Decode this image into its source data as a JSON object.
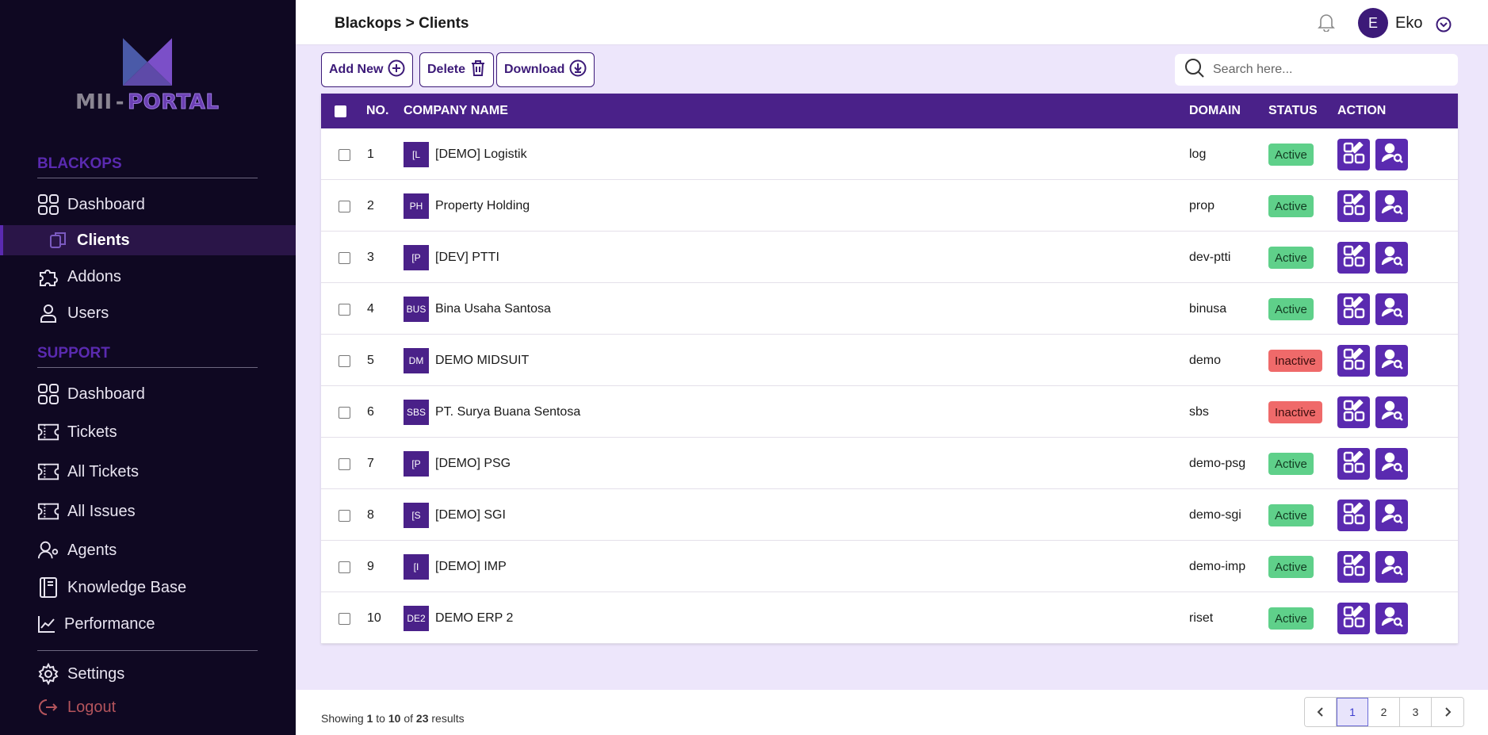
{
  "app": {
    "logo": {
      "part1": "MII",
      "separator": "-",
      "part2": "PORTAL"
    }
  },
  "sidebar": {
    "section1": "BLACKOPS",
    "section1_items": [
      {
        "label": "Dashboard",
        "icon": "grid-icon"
      },
      {
        "label": "Clients",
        "icon": "clients-icon",
        "active": true
      },
      {
        "label": "Addons",
        "icon": "puzzle-icon"
      },
      {
        "label": "Users",
        "icon": "user-icon"
      }
    ],
    "section2": "SUPPORT",
    "section2_items": [
      {
        "label": "Dashboard",
        "icon": "grid-icon"
      },
      {
        "label": "Tickets",
        "icon": "ticket-icon"
      },
      {
        "label": "All Tickets",
        "icon": "ticket-icon"
      },
      {
        "label": "All Issues",
        "icon": "ticket-icon"
      },
      {
        "label": "Agents",
        "icon": "agent-icon"
      },
      {
        "label": "Knowledge Base",
        "icon": "book-icon"
      },
      {
        "label": "Performance",
        "icon": "chart-line-icon"
      }
    ],
    "settings": "Settings",
    "logout": "Logout"
  },
  "header": {
    "breadcrumb": "Blackops > Clients",
    "user_initial": "E",
    "user_name": "Eko"
  },
  "toolbar": {
    "add_label": "Add New",
    "delete_label": "Delete",
    "download_label": "Download",
    "search_placeholder": "Search here..."
  },
  "table": {
    "columns": {
      "no": "NO.",
      "company": "COMPANY NAME",
      "domain": "DOMAIN",
      "status": "STATUS",
      "action": "ACTION"
    },
    "rows": [
      {
        "no": "1",
        "badge": "[L",
        "name": "[DEMO] Logistik",
        "domain": "log",
        "status": "Active"
      },
      {
        "no": "2",
        "badge": "PH",
        "name": "Property Holding",
        "domain": "prop",
        "status": "Active"
      },
      {
        "no": "3",
        "badge": "[P",
        "name": "[DEV] PTTI",
        "domain": "dev-ptti",
        "status": "Active"
      },
      {
        "no": "4",
        "badge": "BUS",
        "name": "Bina Usaha Santosa",
        "domain": "binusa",
        "status": "Active"
      },
      {
        "no": "5",
        "badge": "DM",
        "name": "DEMO MIDSUIT",
        "domain": "demo",
        "status": "Inactive"
      },
      {
        "no": "6",
        "badge": "SBS",
        "name": "PT. Surya Buana Sentosa",
        "domain": "sbs",
        "status": "Inactive"
      },
      {
        "no": "7",
        "badge": "[P",
        "name": "[DEMO] PSG",
        "domain": "demo-psg",
        "status": "Active"
      },
      {
        "no": "8",
        "badge": "[S",
        "name": "[DEMO] SGI",
        "domain": "demo-sgi",
        "status": "Active"
      },
      {
        "no": "9",
        "badge": "[I",
        "name": "[DEMO] IMP",
        "domain": "demo-imp",
        "status": "Active"
      },
      {
        "no": "10",
        "badge": "DE2",
        "name": "DEMO ERP 2",
        "domain": "riset",
        "status": "Active"
      }
    ]
  },
  "footer": {
    "showing_prefix": "Showing",
    "from": "1",
    "to_word": "to",
    "to": "10",
    "of_word": "of",
    "total": "23",
    "suffix": "results",
    "pages": [
      "1",
      "2",
      "3"
    ],
    "current_page": "1"
  },
  "colors": {
    "primary": "#4a2189",
    "sidebar_bg": "#0f0822",
    "active_status": "#5fd08a",
    "inactive_status": "#ef6a6a"
  }
}
